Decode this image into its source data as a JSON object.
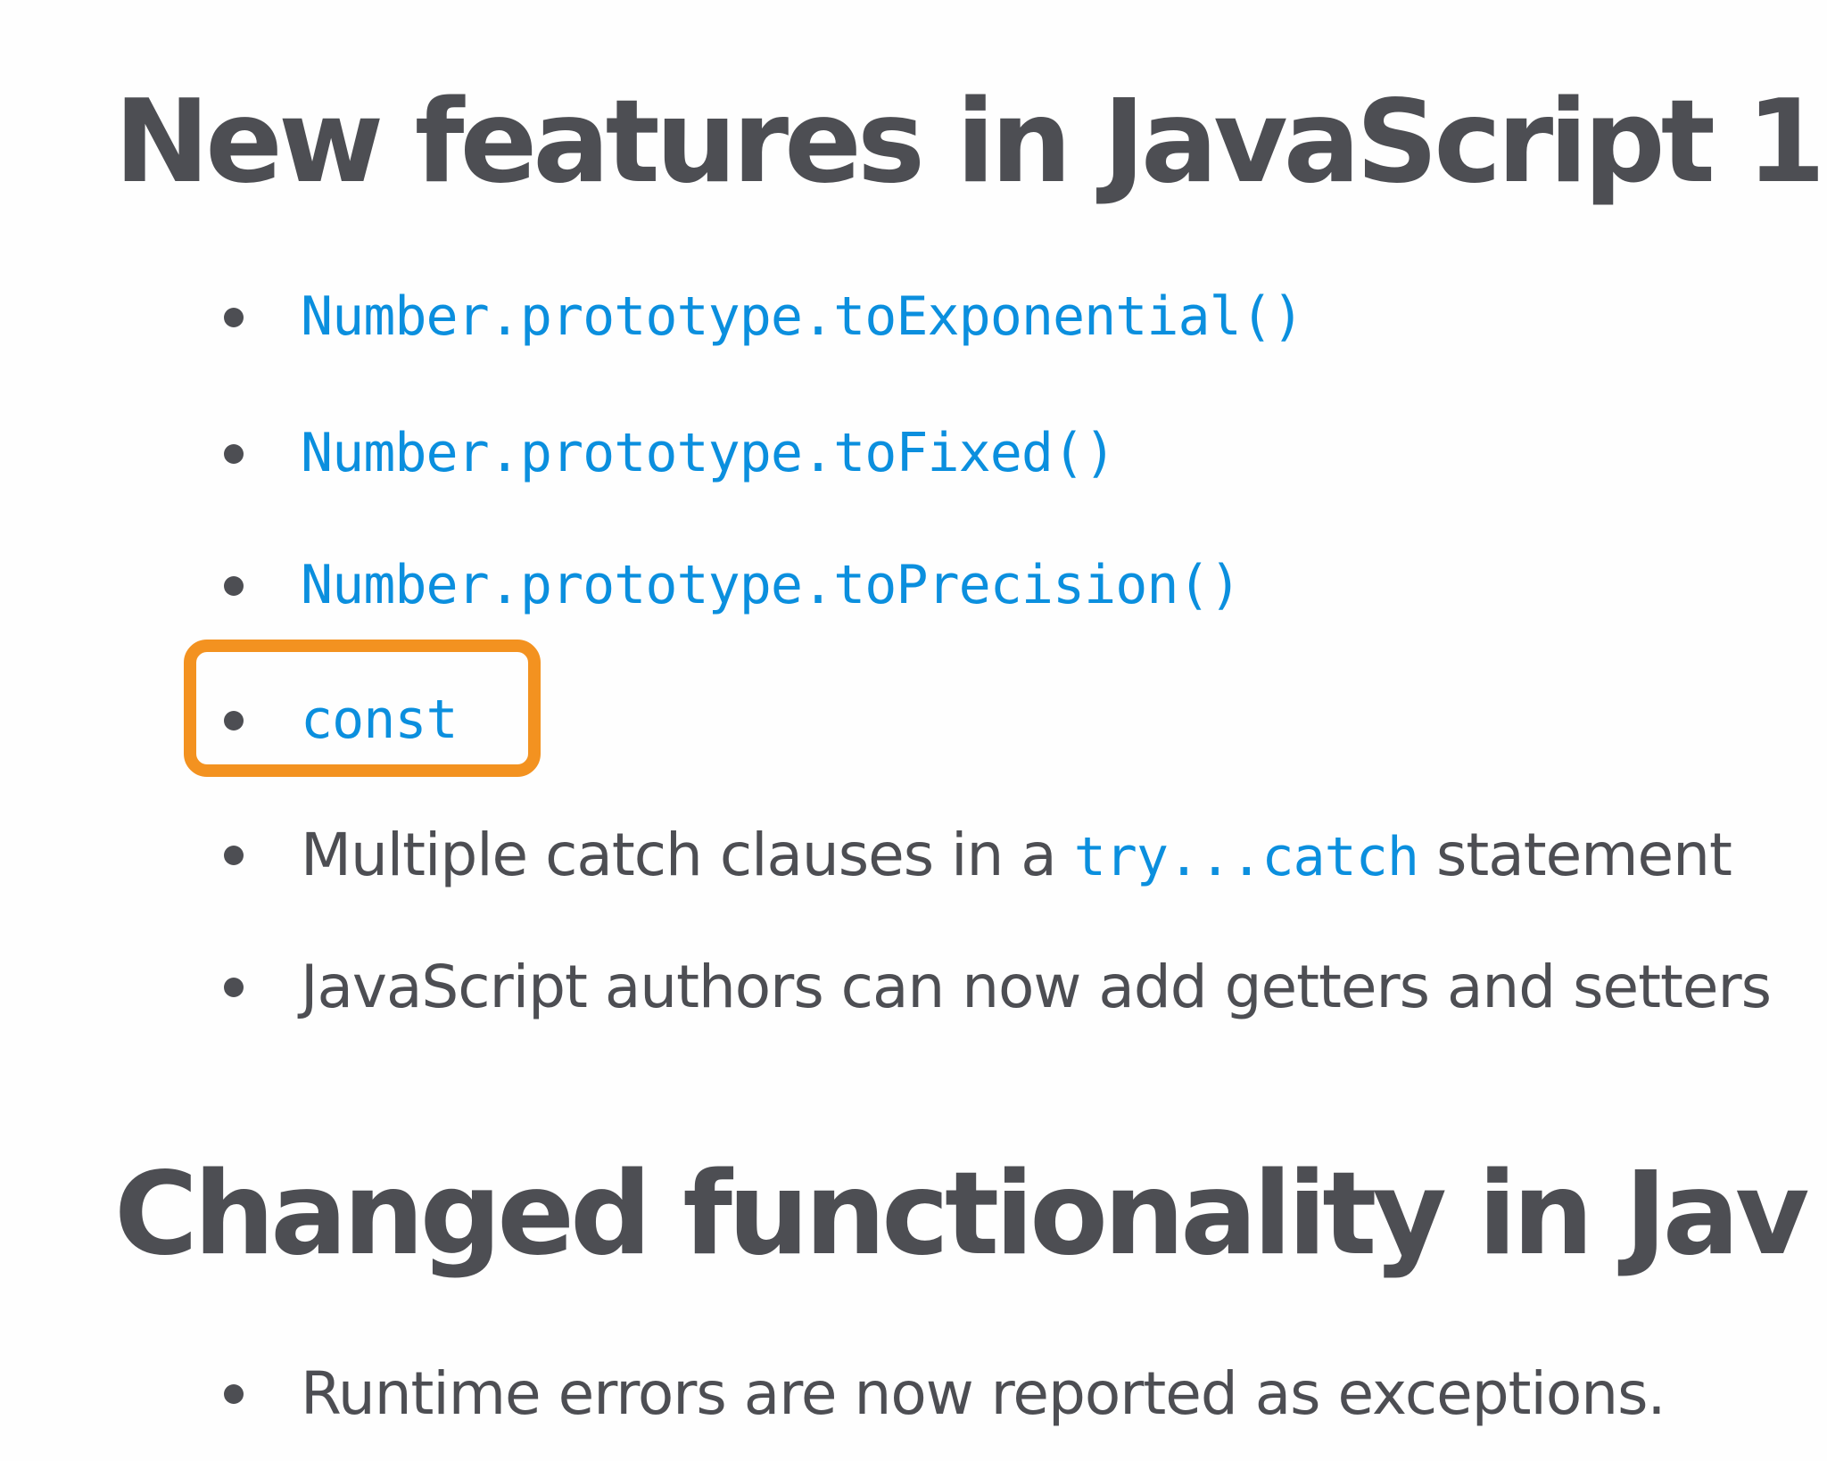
{
  "section1": {
    "heading": "New features in JavaScript 1",
    "items": [
      {
        "label": "Number.prototype.toExponential()"
      },
      {
        "label": "Number.prototype.toFixed()"
      },
      {
        "label": "Number.prototype.toPrecision()"
      },
      {
        "label": "const"
      },
      {
        "before": "Multiple catch clauses in a ",
        "code": "try...catch",
        "after": " statement"
      },
      {
        "text": "JavaScript authors can now add getters and setters"
      }
    ]
  },
  "section2": {
    "heading": "Changed functionality in Jav",
    "items": [
      {
        "text": "Runtime errors are now reported as exceptions."
      }
    ]
  },
  "colors": {
    "text": "#4d4e53",
    "link": "#0b8fde",
    "highlight": "#f39220",
    "background": "#fefefe"
  }
}
